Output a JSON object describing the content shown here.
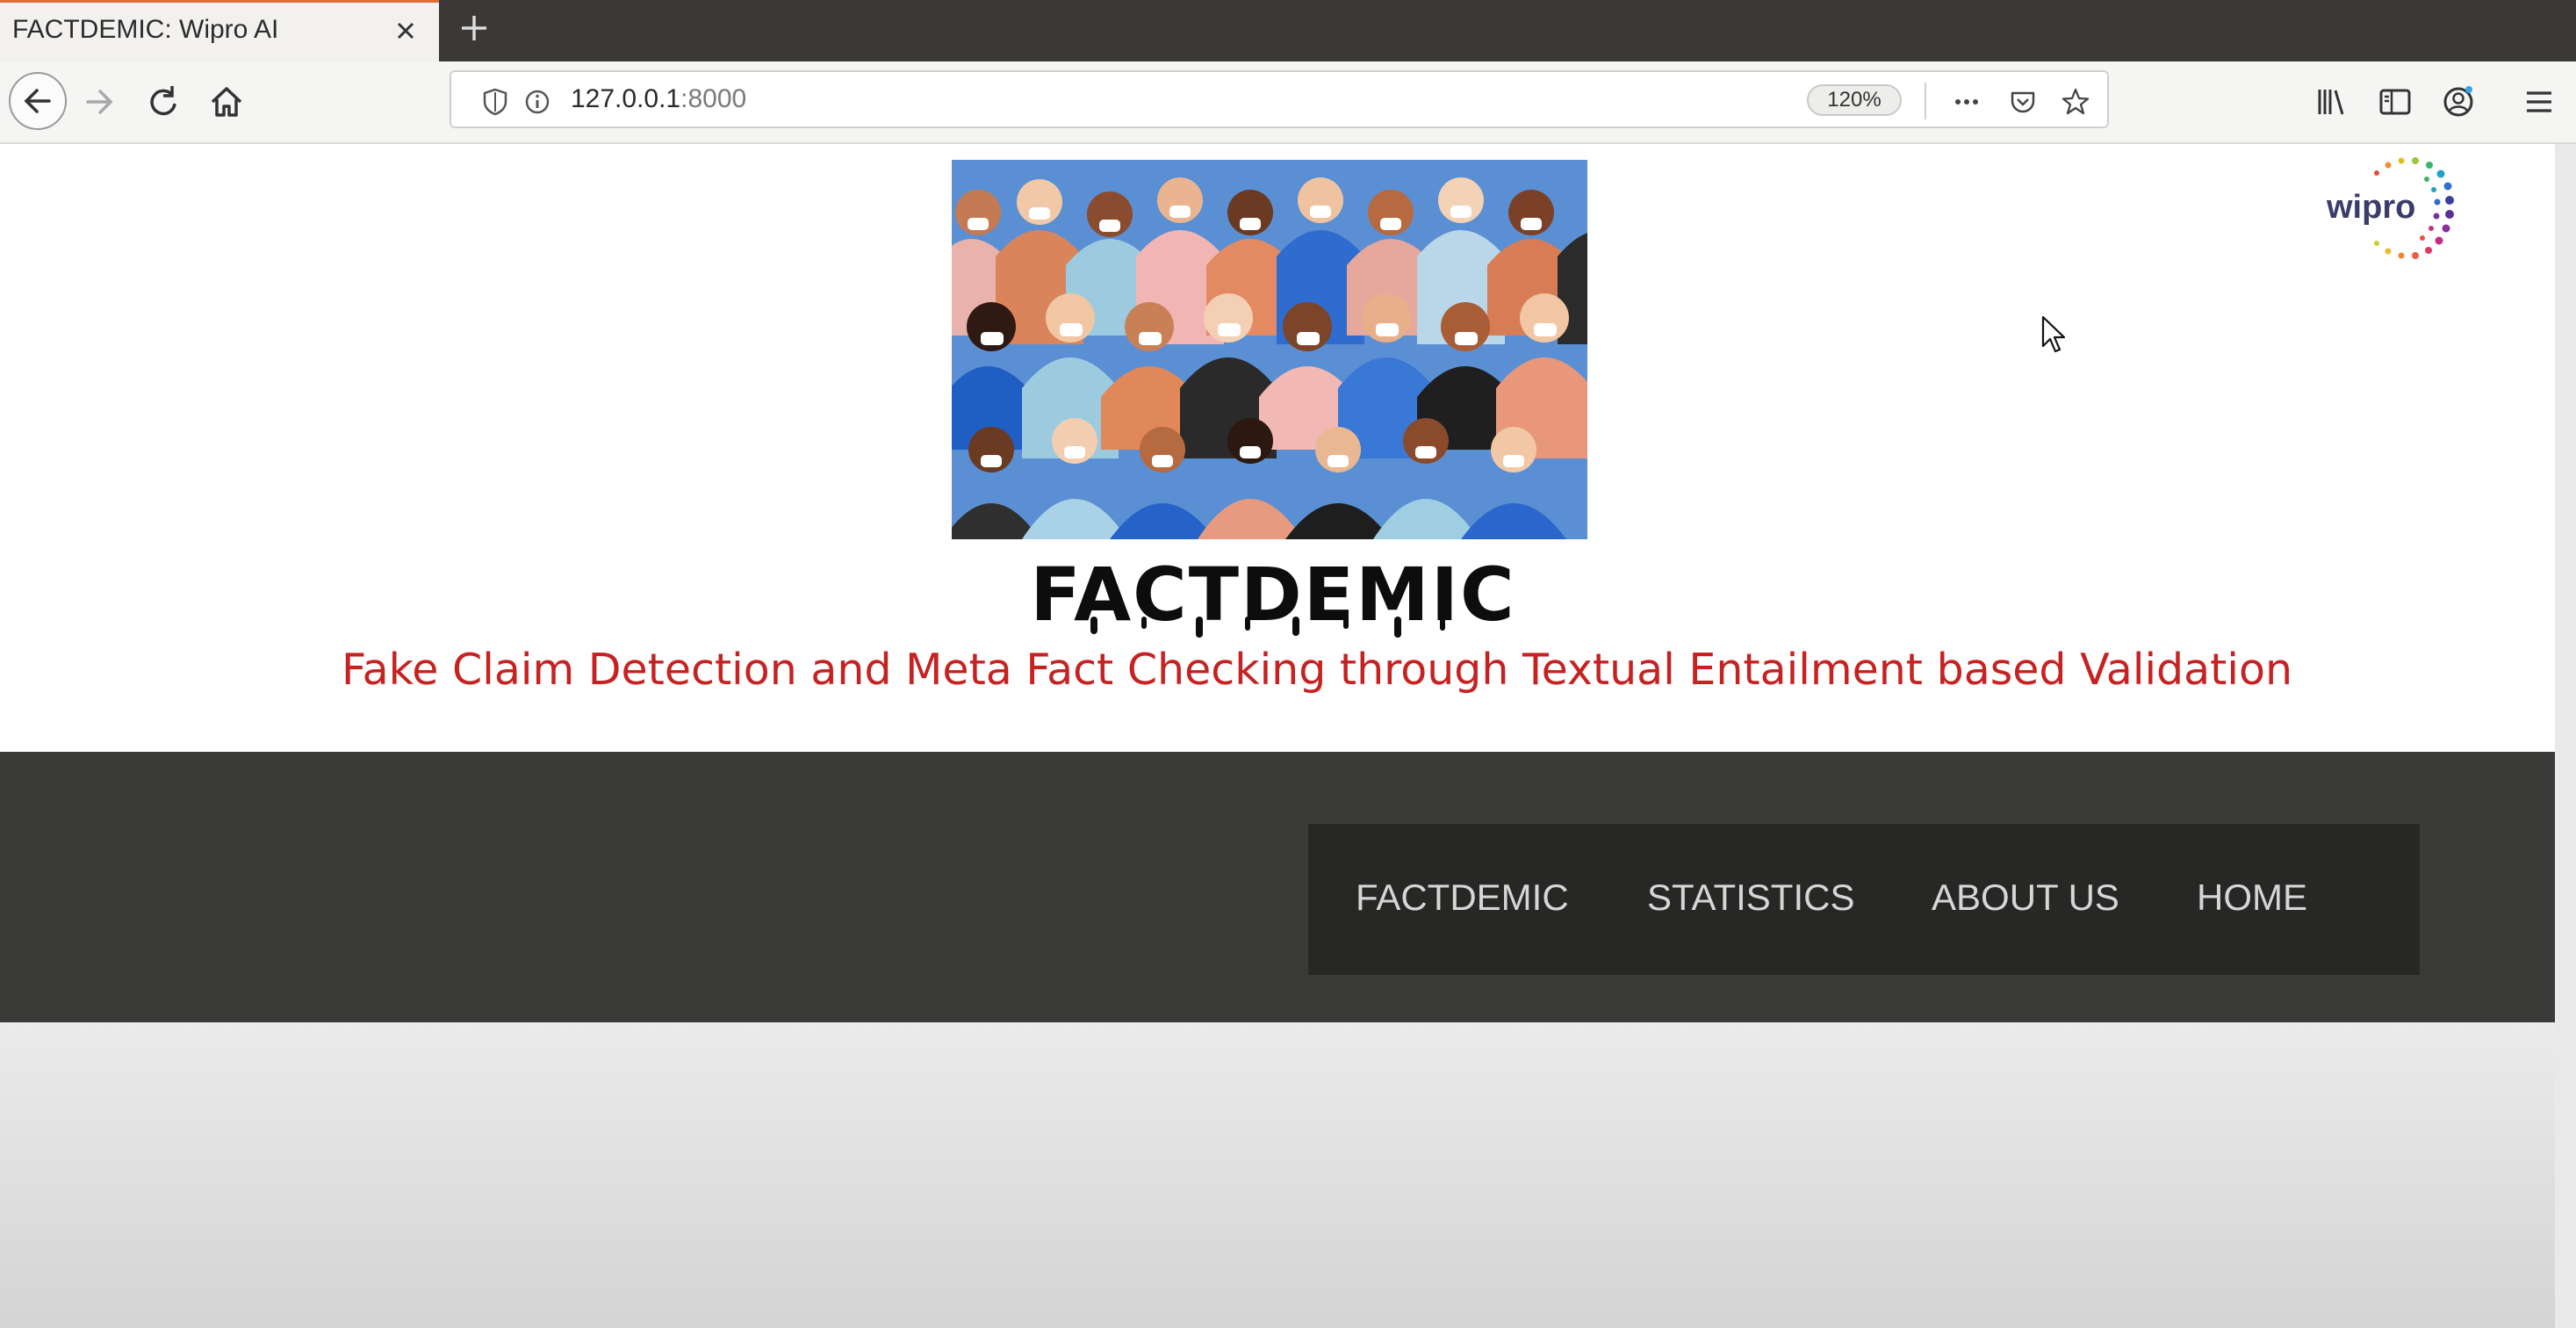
{
  "browser": {
    "tab_title": "FACTDEMIC: Wipro AI",
    "url_host": "127.0.0.1",
    "url_port": ":8000",
    "zoom": "120%"
  },
  "page": {
    "logo_brand": "wipro",
    "site_title": "FACTDEMIC",
    "tagline": "Fake Claim Detection and Meta Fact Checking through Textual Entailment based Validation",
    "nav": [
      {
        "label": "FACTDEMIC"
      },
      {
        "label": "STATISTICS"
      },
      {
        "label": "ABOUT US"
      },
      {
        "label": "HOME"
      }
    ]
  },
  "colors": {
    "tagline": "#c62222",
    "menu_band": "#3a3a38",
    "menu_box": "#272725",
    "tab_accent": "#e66a33"
  },
  "icons": [
    "close-icon",
    "plus-icon",
    "back-arrow-icon",
    "forward-arrow-icon",
    "reload-icon",
    "home-icon",
    "shield-icon",
    "info-icon",
    "more-dots-icon",
    "pocket-icon",
    "star-icon",
    "library-icon",
    "sidebar-icon",
    "account-icon",
    "hamburger-menu-icon"
  ]
}
